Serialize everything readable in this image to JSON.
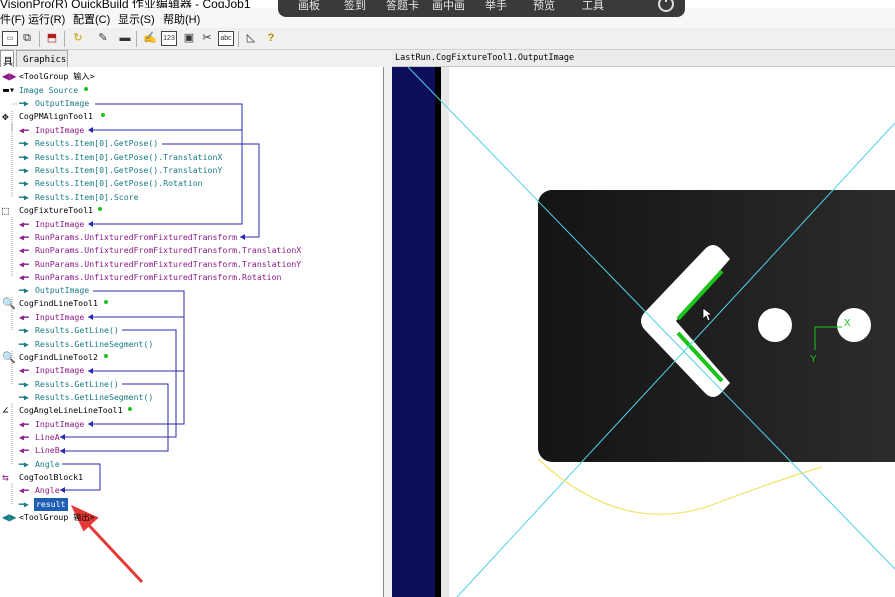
{
  "window": {
    "title": "VisionPro(R) QuickBuild 作业编辑器 - CogJob1"
  },
  "overlay_toolbar": {
    "items": [
      "画板",
      "签到",
      "答题卡",
      "画中画",
      "举手",
      "预览",
      "工具"
    ]
  },
  "menu": {
    "items": [
      "件(F)",
      "运行(R)",
      "配置(C)",
      "显示(S)",
      "帮助(H)"
    ]
  },
  "tabs": {
    "active": "具",
    "graphics": "Graphics"
  },
  "tree": {
    "root_in": "<ToolGroup 输入>",
    "image_source": "Image Source",
    "is_output": "OutputImage",
    "pm_tool": "CogPMAlignTool1",
    "pm_input": "InputImage",
    "pm_r1": "Results.Item[0].GetPose()",
    "pm_r2": "Results.Item[0].GetPose().TranslationX",
    "pm_r3": "Results.Item[0].GetPose().TranslationY",
    "pm_r4": "Results.Item[0].GetPose().Rotation",
    "pm_r5": "Results.Item[0].Score",
    "fx_tool": "CogFixtureTool1",
    "fx_input": "InputImage",
    "fx_p1": "RunParams.UnfixturedFromFixturedTransform",
    "fx_p2": "RunParams.UnfixturedFromFixturedTransform.TranslationX",
    "fx_p3": "RunParams.UnfixturedFromFixturedTransform.TranslationY",
    "fx_p4": "RunParams.UnfixturedFromFixturedTransform.Rotation",
    "fx_output": "OutputImage",
    "fl1_tool": "CogFindLineTool1",
    "fl1_input": "InputImage",
    "fl1_r1": "Results.GetLine()",
    "fl1_r2": "Results.GetLineSegment()",
    "fl2_tool": "CogFindLineTool2",
    "fl2_input": "InputImage",
    "fl2_r1": "Results.GetLine()",
    "fl2_r2": "Results.GetLineSegment()",
    "al_tool": "CogAngleLineLineTool1",
    "al_input": "InputImage",
    "al_linea": "LineA",
    "al_lineb": "LineB",
    "al_angle": "Angle",
    "tb_tool": "CogToolBlock1",
    "tb_angle": "Angle",
    "tb_result": "result",
    "root_out": "<ToolGroup 输出>"
  },
  "image_panel": {
    "title": "LastRun.CogFixtureTool1.OutputImage",
    "axis_x": "X",
    "axis_y": "Y"
  },
  "colors": {
    "output_arrow": "#1a7a86",
    "input_arrow": "#8a1a86",
    "link_line": "#2a2ab0",
    "status_dot": "#1bc41b",
    "selection": "#1e5fb4",
    "annotation_arrow": "#e53935"
  }
}
